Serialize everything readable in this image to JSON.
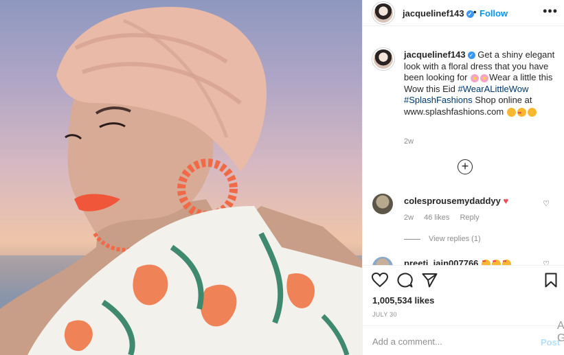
{
  "post_header": {
    "username": "jacquelinef143",
    "separator": "•",
    "follow_label": "Follow",
    "more_label": "•••"
  },
  "caption": {
    "username": "jacquelinef143",
    "text_before": "Get a shiny elegant look with a floral dress that you have been looking for",
    "text_after": "Wear a little this Wow this Eid",
    "hashtags": "#WearALittleWow #SplashFashions",
    "text_end": "Shop online at www.splashfashions.com",
    "time": "2w"
  },
  "comments": [
    {
      "username": "colesprousemydaddyy",
      "time": "2w",
      "likes": "46 likes",
      "reply_label": "Reply",
      "view_replies": "View replies (1)"
    },
    {
      "username": "preeti_jain007766"
    }
  ],
  "actions": {
    "like_count": "1,005,534 likes",
    "date": "JULY 30"
  },
  "add_comment": {
    "placeholder": "Add a comment...",
    "post_label": "Post"
  },
  "watermark": {
    "line1": "A",
    "line2": "G"
  },
  "icons": {
    "verified": "verified-badge-icon",
    "like": "heart-outline-icon",
    "comment": "speech-bubble-icon",
    "share": "paper-plane-icon",
    "save": "bookmark-icon",
    "load_more": "plus-circle-icon"
  },
  "colors": {
    "link_blue": "#0095f6",
    "hashtag_blue": "#00376b",
    "verified_blue": "#3897f0",
    "muted_gray": "#8e8e8e",
    "post_disabled": "#b2dffc"
  }
}
